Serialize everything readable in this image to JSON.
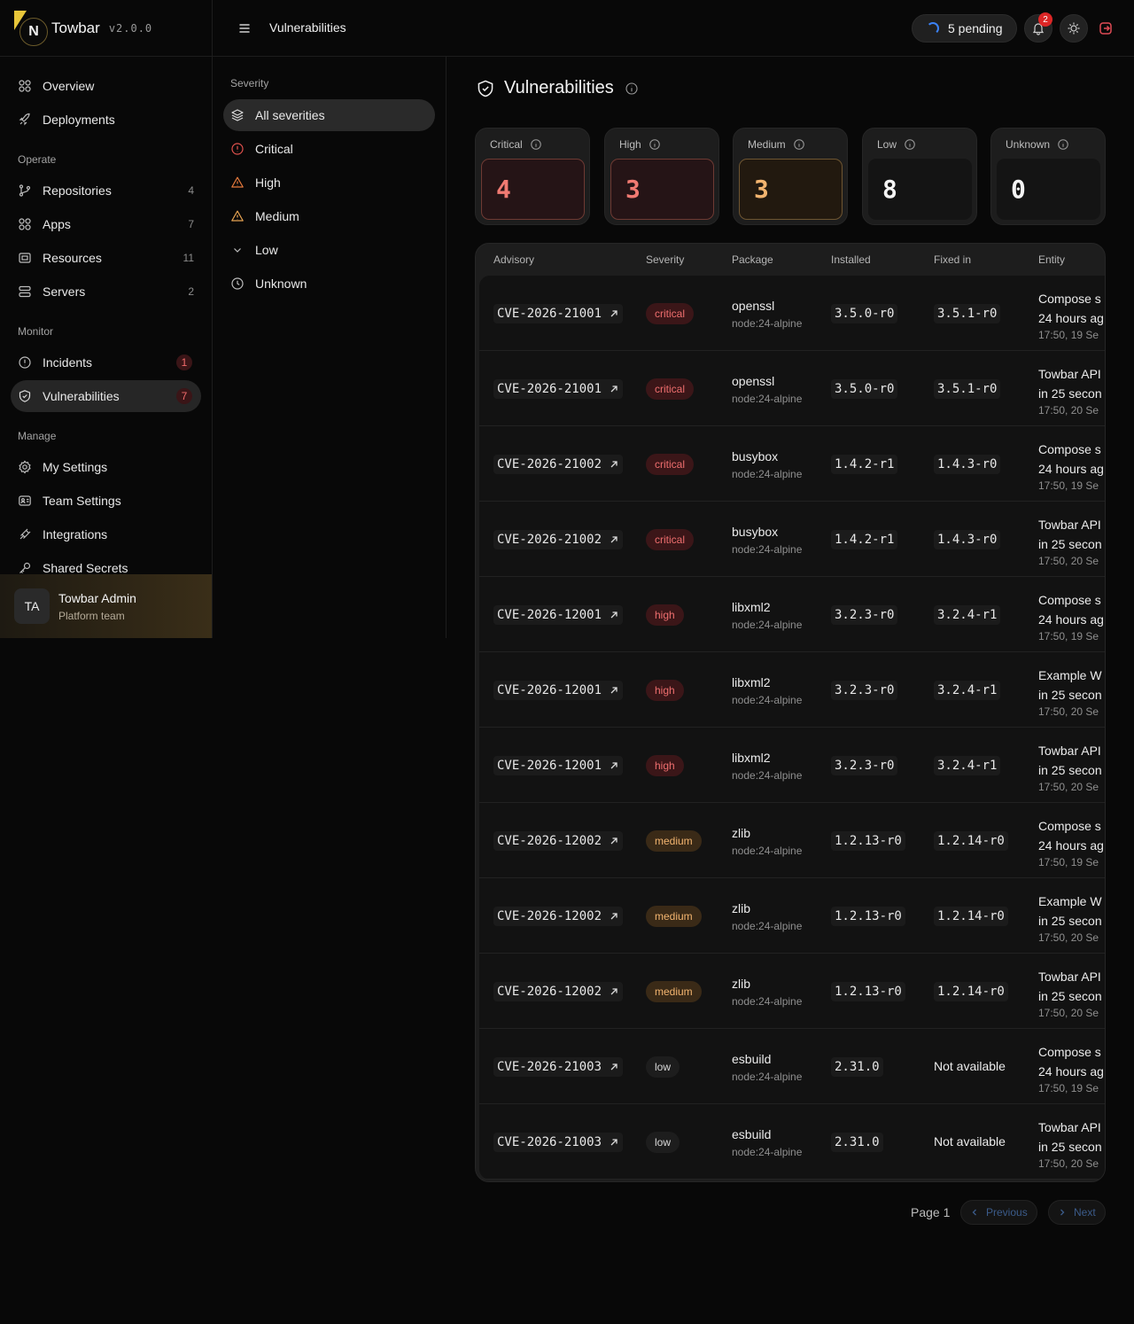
{
  "app": {
    "name": "Towbar",
    "version": "v2.0.0",
    "logo_letter": "N"
  },
  "header": {
    "page_title": "Vulnerabilities",
    "pending_label": "5 pending",
    "notification_count": "2"
  },
  "sidebar": {
    "top_items": [
      {
        "label": "Overview",
        "icon": "grid-icon"
      },
      {
        "label": "Deployments",
        "icon": "rocket-icon"
      }
    ],
    "groups": [
      {
        "title": "Operate",
        "items": [
          {
            "label": "Repositories",
            "count": "4",
            "icon": "git-branch-icon"
          },
          {
            "label": "Apps",
            "count": "7",
            "icon": "grid-icon"
          },
          {
            "label": "Resources",
            "count": "11",
            "icon": "box-icon"
          },
          {
            "label": "Servers",
            "count": "2",
            "icon": "server-icon"
          }
        ]
      },
      {
        "title": "Monitor",
        "items": [
          {
            "label": "Incidents",
            "count": "1",
            "icon": "alert-circle-icon"
          },
          {
            "label": "Vulnerabilities",
            "count": "7",
            "icon": "shield-icon"
          }
        ]
      },
      {
        "title": "Manage",
        "items": [
          {
            "label": "My Settings",
            "icon": "gear-icon"
          },
          {
            "label": "Team Settings",
            "icon": "id-card-icon"
          },
          {
            "label": "Integrations",
            "icon": "plug-icon"
          },
          {
            "label": "Shared Secrets",
            "icon": "key-icon"
          }
        ]
      }
    ],
    "user": {
      "initials": "TA",
      "name": "Towbar Admin",
      "team": "Platform team"
    }
  },
  "filter": {
    "title": "Severity",
    "items": [
      {
        "label": "All severities",
        "icon": "layers-icon",
        "active": true
      },
      {
        "label": "Critical",
        "icon": "alert-circle-icon"
      },
      {
        "label": "High",
        "icon": "warning-triangle-icon"
      },
      {
        "label": "Medium",
        "icon": "warning-triangle-icon"
      },
      {
        "label": "Low",
        "icon": "chevron-down-icon"
      },
      {
        "label": "Unknown",
        "icon": "clock-icon"
      }
    ]
  },
  "main": {
    "title": "Vulnerabilities",
    "stats": [
      {
        "label": "Critical",
        "value": "4"
      },
      {
        "label": "High",
        "value": "3"
      },
      {
        "label": "Medium",
        "value": "3"
      },
      {
        "label": "Low",
        "value": "8"
      },
      {
        "label": "Unknown",
        "value": "0"
      }
    ],
    "columns": [
      "Advisory",
      "Severity",
      "Package",
      "Installed",
      "Fixed in",
      "Entity"
    ],
    "rows": [
      {
        "advisory": "CVE-2026-21001",
        "severity": "critical",
        "package": "openssl",
        "image": "node:24-alpine",
        "installed": "3.5.0-r0",
        "fixed": "3.5.1-r0",
        "entity": "Compose s",
        "entity_time": "24 hours ag",
        "entity_date": "17:50, 19 Se"
      },
      {
        "advisory": "CVE-2026-21001",
        "severity": "critical",
        "package": "openssl",
        "image": "node:24-alpine",
        "installed": "3.5.0-r0",
        "fixed": "3.5.1-r0",
        "entity": "Towbar API",
        "entity_time": "in 25 secon",
        "entity_date": "17:50, 20 Se"
      },
      {
        "advisory": "CVE-2026-21002",
        "severity": "critical",
        "package": "busybox",
        "image": "node:24-alpine",
        "installed": "1.4.2-r1",
        "fixed": "1.4.3-r0",
        "entity": "Compose s",
        "entity_time": "24 hours ag",
        "entity_date": "17:50, 19 Se"
      },
      {
        "advisory": "CVE-2026-21002",
        "severity": "critical",
        "package": "busybox",
        "image": "node:24-alpine",
        "installed": "1.4.2-r1",
        "fixed": "1.4.3-r0",
        "entity": "Towbar API",
        "entity_time": "in 25 secon",
        "entity_date": "17:50, 20 Se"
      },
      {
        "advisory": "CVE-2026-12001",
        "severity": "high",
        "package": "libxml2",
        "image": "node:24-alpine",
        "installed": "3.2.3-r0",
        "fixed": "3.2.4-r1",
        "entity": "Compose s",
        "entity_time": "24 hours ag",
        "entity_date": "17:50, 19 Se"
      },
      {
        "advisory": "CVE-2026-12001",
        "severity": "high",
        "package": "libxml2",
        "image": "node:24-alpine",
        "installed": "3.2.3-r0",
        "fixed": "3.2.4-r1",
        "entity": "Example W",
        "entity_time": "in 25 secon",
        "entity_date": "17:50, 20 Se"
      },
      {
        "advisory": "CVE-2026-12001",
        "severity": "high",
        "package": "libxml2",
        "image": "node:24-alpine",
        "installed": "3.2.3-r0",
        "fixed": "3.2.4-r1",
        "entity": "Towbar API",
        "entity_time": "in 25 secon",
        "entity_date": "17:50, 20 Se"
      },
      {
        "advisory": "CVE-2026-12002",
        "severity": "medium",
        "package": "zlib",
        "image": "node:24-alpine",
        "installed": "1.2.13-r0",
        "fixed": "1.2.14-r0",
        "entity": "Compose s",
        "entity_time": "24 hours ag",
        "entity_date": "17:50, 19 Se"
      },
      {
        "advisory": "CVE-2026-12002",
        "severity": "medium",
        "package": "zlib",
        "image": "node:24-alpine",
        "installed": "1.2.13-r0",
        "fixed": "1.2.14-r0",
        "entity": "Example W",
        "entity_time": "in 25 secon",
        "entity_date": "17:50, 20 Se"
      },
      {
        "advisory": "CVE-2026-12002",
        "severity": "medium",
        "package": "zlib",
        "image": "node:24-alpine",
        "installed": "1.2.13-r0",
        "fixed": "1.2.14-r0",
        "entity": "Towbar API",
        "entity_time": "in 25 secon",
        "entity_date": "17:50, 20 Se"
      },
      {
        "advisory": "CVE-2026-21003",
        "severity": "low",
        "package": "esbuild",
        "image": "node:24-alpine",
        "installed": "2.31.0",
        "fixed": "Not available",
        "entity": "Compose s",
        "entity_time": "24 hours ag",
        "entity_date": "17:50, 19 Se"
      },
      {
        "advisory": "CVE-2026-21003",
        "severity": "low",
        "package": "esbuild",
        "image": "node:24-alpine",
        "installed": "2.31.0",
        "fixed": "Not available",
        "entity": "Towbar API",
        "entity_time": "in 25 secon",
        "entity_date": "17:50, 20 Se"
      }
    ],
    "pagination": {
      "page_label": "Page 1",
      "previous": "Previous",
      "next": "Next"
    }
  },
  "colors": {
    "accent_gold": "#e8c63a",
    "critical": "#ee6e6e",
    "medium": "#f2b46f",
    "link_blue": "#3b5b8a",
    "spinner": "#3b82f6"
  }
}
